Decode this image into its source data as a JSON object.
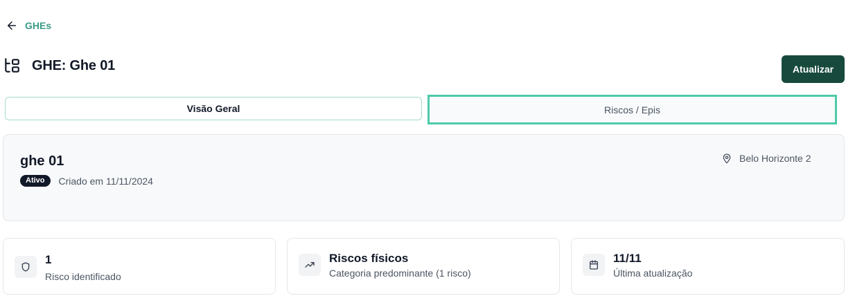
{
  "breadcrumb": {
    "back_label": "GHEs"
  },
  "header": {
    "title": "GHE: Ghe 01",
    "update_button": "Atualizar"
  },
  "tabs": [
    {
      "label": "Visão Geral"
    },
    {
      "label": "Riscos / Epis"
    }
  ],
  "info": {
    "name": "ghe 01",
    "status": "Ativo",
    "created": "Criado em 11/11/2024",
    "location": "Belo Horizonte 2"
  },
  "stats": [
    {
      "icon": "shield-icon",
      "value": "1",
      "label": "Risco identificado"
    },
    {
      "icon": "trending-up-icon",
      "value": "Riscos físicos",
      "label": "Categoria predominante (1 risco)"
    },
    {
      "icon": "calendar-icon",
      "value": "11/11",
      "label": "Última atualização"
    }
  ],
  "colors": {
    "accent": "#3a9a86",
    "primary_button": "#174a3d",
    "active_tab_border": "#4ccaa8",
    "badge": "#111827"
  }
}
